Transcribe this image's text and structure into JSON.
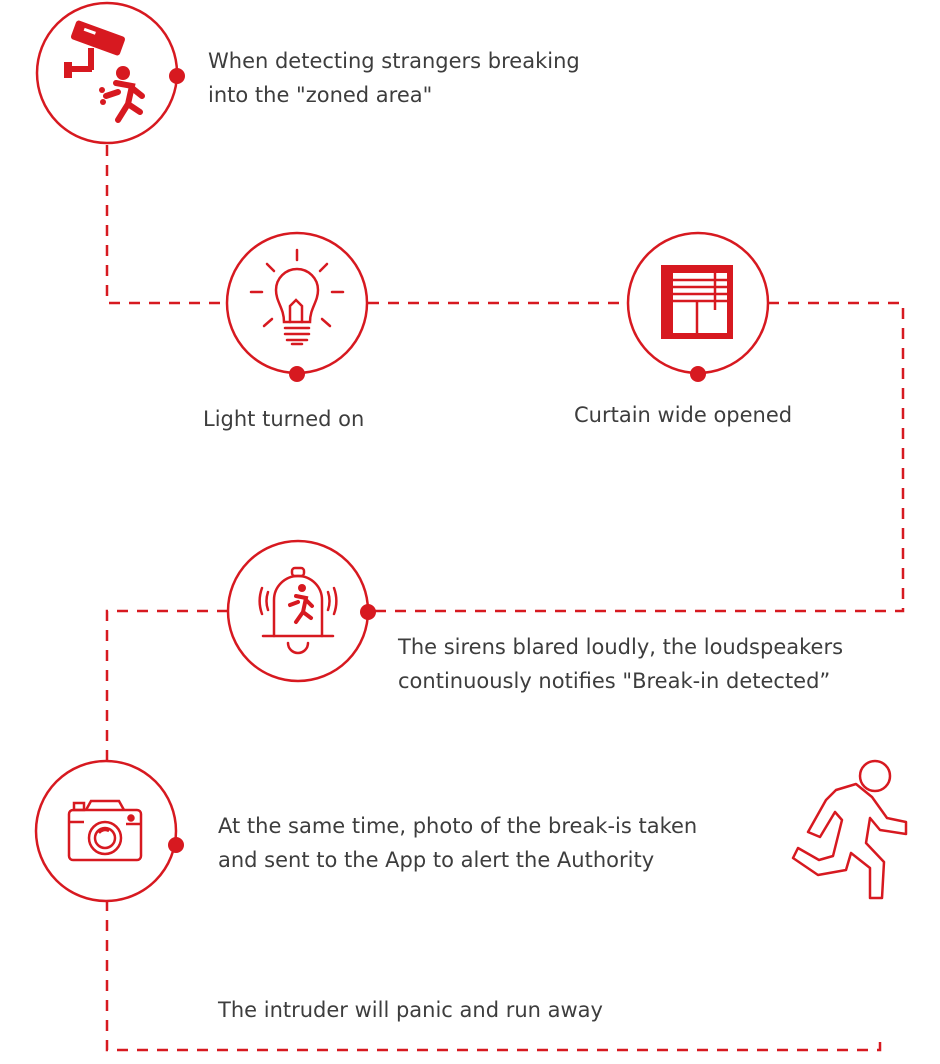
{
  "accent": "#d71920",
  "steps": [
    {
      "icon": "cctv-intruder-icon",
      "lines": [
        "When detecting strangers breaking",
        "into the \"zoned area\""
      ]
    },
    {
      "icon": "light-bulb-icon",
      "lines": [
        "Light turned on"
      ]
    },
    {
      "icon": "curtain-icon",
      "lines": [
        "Curtain wide opened"
      ]
    },
    {
      "icon": "siren-bell-icon",
      "lines": [
        "The sirens blared loudly, the loudspeakers",
        "continuously notifies \"Break-in detected”"
      ]
    },
    {
      "icon": "camera-icon",
      "lines": [
        "At the same time, photo of the break-is taken",
        "and sent to the App to alert the Authority"
      ]
    },
    {
      "icon": "running-person-icon",
      "lines": [
        "The intruder will panic and run away"
      ]
    }
  ]
}
